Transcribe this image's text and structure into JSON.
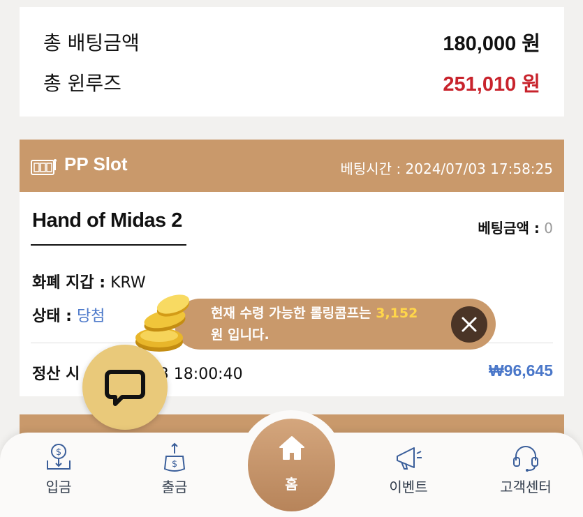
{
  "summary": {
    "total_bet_label": "총 배팅금액",
    "total_bet_value": "180,000 원",
    "total_winloss_label": "총 윈루즈",
    "total_winloss_value": "251,010 원"
  },
  "bet": {
    "game_type": "PP Slot",
    "bet_time": "베팅시간 : 2024/07/03 17:58:25",
    "game_name": "Hand of Midas 2",
    "bet_amount_label": "베팅금액 :",
    "bet_amount_value": "0",
    "wallet_label": "화폐 지갑 :",
    "wallet_value": "KRW",
    "status_label": "상태 :",
    "status_value": "당첨",
    "settle_label": "정산 시",
    "settle_time": "07/03 18:00:40",
    "settle_amount": "₩96,645"
  },
  "toast": {
    "text_pre": "현재 수령 가능한 롤링콤프는",
    "amount": "3,152",
    "text_post": "원 입니다."
  },
  "nav": {
    "deposit": "입금",
    "withdraw": "출금",
    "home": "홈",
    "event": "이벤트",
    "support": "고객센터"
  },
  "colors": {
    "accent": "#c9996b",
    "red": "#c8232c",
    "blue": "#4a77c9",
    "chat": "#e9c97a"
  },
  "icons": [
    "slot-machine-icon",
    "chat-icon",
    "close-icon",
    "coins-icon",
    "deposit-icon",
    "withdraw-icon",
    "home-icon",
    "megaphone-icon",
    "headset-icon"
  ]
}
